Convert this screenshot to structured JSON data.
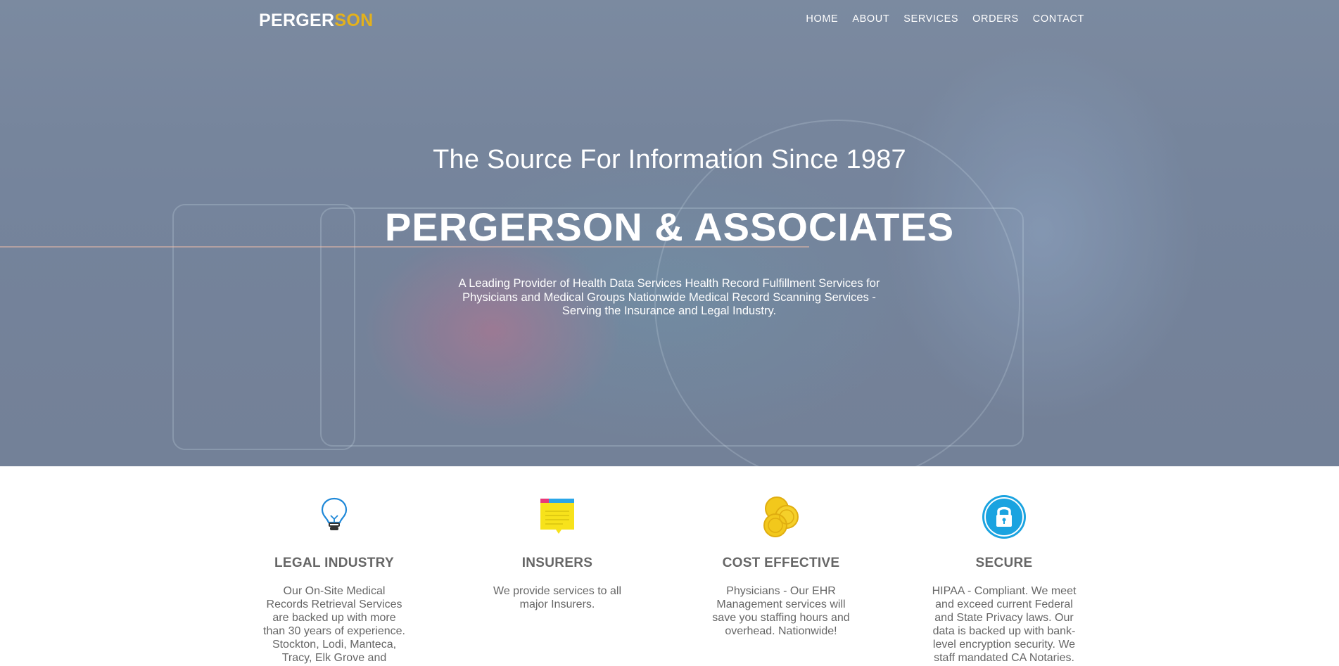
{
  "nav": {
    "logo_part1": "PERGER",
    "logo_part2": "SON",
    "items": [
      "HOME",
      "ABOUT",
      "SERVICES",
      "ORDERS",
      "CONTACT"
    ]
  },
  "hero": {
    "tagline": "The Source For Information Since 1987",
    "headline": "PERGERSON & ASSOCIATES",
    "description": "A Leading Provider of Health Data Services Health Record Fulfillment Services for Physicians and Medical Groups Nationwide Medical Record Scanning Services - Serving the Insurance and Legal Industry."
  },
  "features": [
    {
      "icon": "lightbulb-icon",
      "title": "LEGAL INDUSTRY",
      "text": "Our On-Site Medical Records Retrieval Services are backed up with more than 30 years of experience. Stockton, Lodi, Manteca, Tracy, Elk Grove and"
    },
    {
      "icon": "sticky-note-icon",
      "title": "INSURERS",
      "text": "We provide services to all major Insurers."
    },
    {
      "icon": "coins-icon",
      "title": "COST EFFECTIVE",
      "text": "Physicians - Our EHR Management services will save you staffing hours and overhead. Nationwide!"
    },
    {
      "icon": "lock-icon",
      "title": "SECURE",
      "text": "HIPAA - Compliant. We meet and exceed current Federal and State Privacy laws. Our data is backed up with bank-level encryption security. We staff mandated CA Notaries."
    }
  ],
  "colors": {
    "logo_accent": "#e3b11c",
    "feature_text": "#666666",
    "lock_blue": "#1aa3e0",
    "coin_gold": "#f2c81c"
  }
}
